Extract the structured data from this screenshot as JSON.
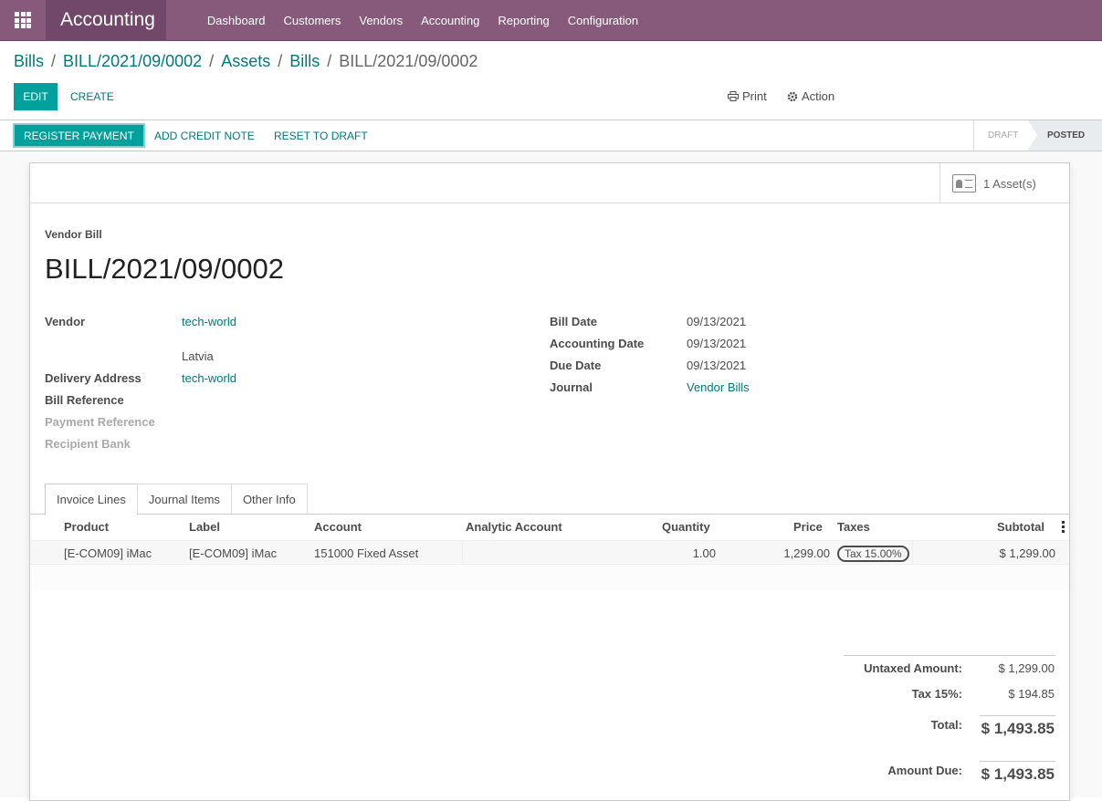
{
  "navbar": {
    "app_name": "Accounting",
    "menu": [
      "Dashboard",
      "Customers",
      "Vendors",
      "Accounting",
      "Reporting",
      "Configuration"
    ]
  },
  "breadcrumb": {
    "items": [
      "Bills",
      "BILL/2021/09/0002",
      "Assets",
      "Bills"
    ],
    "current": "BILL/2021/09/0002"
  },
  "toolbar": {
    "edit": "EDIT",
    "create": "CREATE",
    "print": "Print",
    "action": "Action"
  },
  "statusbar": {
    "register_payment": "REGISTER PAYMENT",
    "add_credit_note": "ADD CREDIT NOTE",
    "reset_to_draft": "RESET TO DRAFT",
    "stages": [
      "DRAFT",
      "POSTED"
    ],
    "active_stage": "POSTED"
  },
  "buttonbox": {
    "assets": "1 Asset(s)"
  },
  "form": {
    "type_label": "Vendor Bill",
    "name": "BILL/2021/09/0002",
    "left_fields": {
      "vendor_label": "Vendor",
      "vendor_value": "tech-world",
      "vendor_country": "Latvia",
      "delivery_label": "Delivery Address",
      "delivery_value": "tech-world",
      "bill_ref_label": "Bill Reference",
      "payment_ref_label": "Payment Reference",
      "recipient_bank_label": "Recipient Bank"
    },
    "right_fields": {
      "bill_date_label": "Bill Date",
      "bill_date_value": "09/13/2021",
      "acc_date_label": "Accounting Date",
      "acc_date_value": "09/13/2021",
      "due_date_label": "Due Date",
      "due_date_value": "09/13/2021",
      "journal_label": "Journal",
      "journal_value": "Vendor Bills"
    }
  },
  "tabs": [
    "Invoice Lines",
    "Journal Items",
    "Other Info"
  ],
  "lines": {
    "headers": [
      "Product",
      "Label",
      "Account",
      "Analytic Account",
      "Quantity",
      "Price",
      "Taxes",
      "Subtotal"
    ],
    "rows": [
      {
        "product": "[E-COM09] iMac",
        "label": "[E-COM09] iMac",
        "account": "151000 Fixed Asset",
        "analytic": "",
        "quantity": "1.00",
        "price": "1,299.00",
        "taxes": "Tax 15.00%",
        "subtotal": "$ 1,299.00"
      }
    ]
  },
  "totals": {
    "untaxed_label": "Untaxed Amount:",
    "untaxed_value": "$ 1,299.00",
    "tax_label": "Tax 15%:",
    "tax_value": "$ 194.85",
    "total_label": "Total:",
    "total_value": "$ 1,493.85",
    "due_label": "Amount Due:",
    "due_value": "$ 1,493.85"
  }
}
